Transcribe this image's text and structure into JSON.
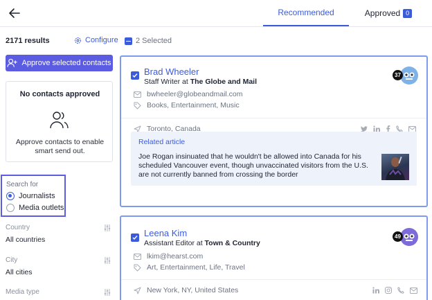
{
  "header": {
    "tabs": [
      {
        "label": "Recommended",
        "active": true
      },
      {
        "label": "Approved",
        "badge": "0",
        "active": false
      }
    ]
  },
  "sidebar": {
    "results_count": "2171 results",
    "configure_label": "Configure",
    "approve_button_label": "Approve selected contacts",
    "empty_state": {
      "title": "No contacts approved",
      "text": "Approve contacts to enable smart send out."
    },
    "search_for": {
      "label": "Search for",
      "options": [
        {
          "label": "Journalists",
          "selected": true
        },
        {
          "label": "Media outlets",
          "selected": false
        }
      ]
    },
    "filters": [
      {
        "label": "Country",
        "value": "All countries"
      },
      {
        "label": "City",
        "value": "All cities"
      },
      {
        "label": "Media type",
        "value": ""
      }
    ]
  },
  "selection": {
    "label": "2 Selected"
  },
  "contacts": [
    {
      "name": "Brad Wheeler",
      "role": "Staff Writer at",
      "outlet": "The Globe and Mail",
      "email": "bwheeler@globeandmail.com",
      "topics": "Books, Entertainment, Music",
      "location": "Toronto,  Canada",
      "score": "37",
      "socials": [
        "twitter-icon",
        "linkedin-icon",
        "facebook-icon",
        "phone-icon",
        "mail-icon"
      ],
      "related": {
        "title": "Related article",
        "text": "Joe Rogan insinuated that he wouldn't be allowed into Canada for his scheduled Vancouver event, though unvaccinated visitors from the U.S. are not currently banned from crossing the border"
      }
    },
    {
      "name": "Leena Kim",
      "role": "Assistant Editor at",
      "outlet": "Town & Country",
      "email": "lkim@hearst.com",
      "topics": "Art, Entertainment, Life, Travel",
      "location": "New York,  NY,  United States",
      "score": "49",
      "socials": [
        "linkedin-icon",
        "instagram-icon",
        "phone-icon",
        "mail-icon"
      ]
    }
  ],
  "colors": {
    "accent": "#3b5bdb",
    "button": "#5b5ce2",
    "highlight_border": "#7d9af0"
  }
}
